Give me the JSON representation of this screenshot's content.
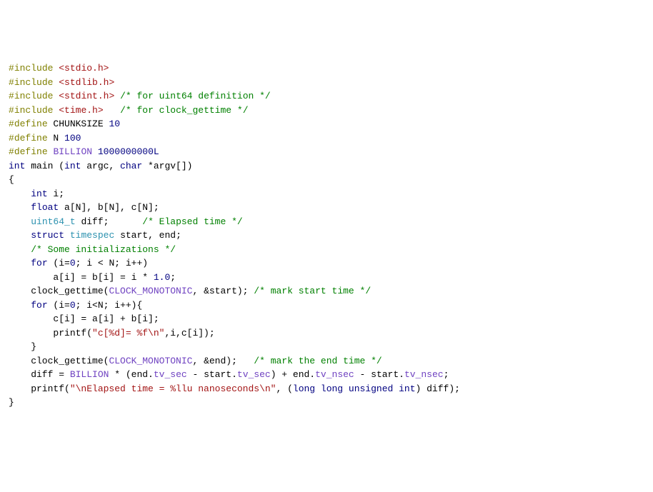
{
  "code": {
    "lines": [
      {
        "tokens": [
          {
            "t": "#",
            "c": "k-pre"
          },
          {
            "t": "include",
            "c": "k-pre"
          },
          {
            "t": " "
          },
          {
            "t": "<stdio.h>",
            "c": "str"
          }
        ]
      },
      {
        "tokens": [
          {
            "t": "#",
            "c": "k-pre"
          },
          {
            "t": "include",
            "c": "k-pre"
          },
          {
            "t": " "
          },
          {
            "t": "<stdlib.h>",
            "c": "str"
          }
        ]
      },
      {
        "tokens": [
          {
            "t": "#",
            "c": "k-pre"
          },
          {
            "t": "include",
            "c": "k-pre"
          },
          {
            "t": " "
          },
          {
            "t": "<stdint.h>",
            "c": "str"
          },
          {
            "t": " "
          },
          {
            "t": "/* for uint64 definition */",
            "c": "cmt"
          }
        ]
      },
      {
        "tokens": [
          {
            "t": "#",
            "c": "k-pre"
          },
          {
            "t": "include",
            "c": "k-pre"
          },
          {
            "t": " "
          },
          {
            "t": "<time.h>",
            "c": "str"
          },
          {
            "t": "   "
          },
          {
            "t": "/* for clock_gettime */",
            "c": "cmt"
          }
        ]
      },
      {
        "tokens": [
          {
            "t": ""
          }
        ]
      },
      {
        "tokens": [
          {
            "t": "#",
            "c": "k-pre"
          },
          {
            "t": "define",
            "c": "k-pre"
          },
          {
            "t": " CHUNKSIZE "
          },
          {
            "t": "10",
            "c": "num"
          }
        ]
      },
      {
        "tokens": [
          {
            "t": "#",
            "c": "k-pre"
          },
          {
            "t": "define",
            "c": "k-pre"
          },
          {
            "t": " N "
          },
          {
            "t": "100",
            "c": "num"
          }
        ]
      },
      {
        "tokens": [
          {
            "t": "#",
            "c": "k-pre"
          },
          {
            "t": "define",
            "c": "k-pre"
          },
          {
            "t": " "
          },
          {
            "t": "BILLION",
            "c": "const"
          },
          {
            "t": " "
          },
          {
            "t": "1000000000L",
            "c": "num"
          }
        ]
      },
      {
        "tokens": [
          {
            "t": ""
          }
        ]
      },
      {
        "tokens": [
          {
            "t": ""
          }
        ]
      },
      {
        "tokens": [
          {
            "t": "int",
            "c": "k-type"
          },
          {
            "t": " main ("
          },
          {
            "t": "int",
            "c": "k-type"
          },
          {
            "t": " argc, "
          },
          {
            "t": "char",
            "c": "k-type"
          },
          {
            "t": " *argv[])"
          }
        ]
      },
      {
        "tokens": [
          {
            "t": "{"
          }
        ]
      },
      {
        "tokens": [
          {
            "t": "    "
          },
          {
            "t": "int",
            "c": "k-type"
          },
          {
            "t": " i;"
          }
        ]
      },
      {
        "tokens": [
          {
            "t": "    "
          },
          {
            "t": "float",
            "c": "k-type"
          },
          {
            "t": " a[N], b[N], c[N];"
          }
        ]
      },
      {
        "tokens": [
          {
            "t": "    "
          },
          {
            "t": "uint64_t",
            "c": "typeuse"
          },
          {
            "t": " diff;      "
          },
          {
            "t": "/* Elapsed time */",
            "c": "cmt"
          }
        ]
      },
      {
        "tokens": [
          {
            "t": "    "
          },
          {
            "t": "struct",
            "c": "k-type"
          },
          {
            "t": " "
          },
          {
            "t": "timespec",
            "c": "typeuse"
          },
          {
            "t": " start, end;"
          }
        ]
      },
      {
        "tokens": [
          {
            "t": ""
          }
        ]
      },
      {
        "tokens": [
          {
            "t": ""
          }
        ]
      },
      {
        "tokens": [
          {
            "t": "    "
          },
          {
            "t": "/* Some initializations */",
            "c": "cmt"
          }
        ]
      },
      {
        "tokens": [
          {
            "t": "    "
          },
          {
            "t": "for",
            "c": "k-ctrl"
          },
          {
            "t": " (i="
          },
          {
            "t": "0",
            "c": "num"
          },
          {
            "t": "; i < N; i++)"
          }
        ]
      },
      {
        "tokens": [
          {
            "t": "        a[i] = b[i] = i * "
          },
          {
            "t": "1.0",
            "c": "num"
          },
          {
            "t": ";"
          }
        ]
      },
      {
        "tokens": [
          {
            "t": ""
          }
        ]
      },
      {
        "tokens": [
          {
            "t": "    clock_gettime("
          },
          {
            "t": "CLOCK_MONOTONIC",
            "c": "const"
          },
          {
            "t": ", &start); "
          },
          {
            "t": "/* mark start time */",
            "c": "cmt"
          }
        ]
      },
      {
        "tokens": [
          {
            "t": "    "
          },
          {
            "t": "for",
            "c": "k-ctrl"
          },
          {
            "t": " (i="
          },
          {
            "t": "0",
            "c": "num"
          },
          {
            "t": "; i<N; i++){"
          }
        ]
      },
      {
        "tokens": [
          {
            "t": "        c[i] = a[i] + b[i];"
          }
        ]
      },
      {
        "tokens": [
          {
            "t": "        printf("
          },
          {
            "t": "\"c[%d]= %f\\n\"",
            "c": "str"
          },
          {
            "t": ",i,c[i]);"
          }
        ]
      },
      {
        "tokens": [
          {
            "t": "    }"
          }
        ]
      },
      {
        "tokens": [
          {
            "t": "    clock_gettime("
          },
          {
            "t": "CLOCK_MONOTONIC",
            "c": "const"
          },
          {
            "t": ", &end);   "
          },
          {
            "t": "/* mark the end time */",
            "c": "cmt"
          }
        ]
      },
      {
        "tokens": [
          {
            "t": ""
          }
        ]
      },
      {
        "tokens": [
          {
            "t": "    diff = "
          },
          {
            "t": "BILLION",
            "c": "const"
          },
          {
            "t": " * (end."
          },
          {
            "t": "tv_sec",
            "c": "member"
          },
          {
            "t": " - start."
          },
          {
            "t": "tv_sec",
            "c": "member"
          },
          {
            "t": ") + end."
          },
          {
            "t": "tv_nsec",
            "c": "member"
          },
          {
            "t": " - start."
          },
          {
            "t": "tv_nsec",
            "c": "member"
          },
          {
            "t": ";"
          }
        ]
      },
      {
        "tokens": [
          {
            "t": "    printf("
          },
          {
            "t": "\"\\nElapsed time = %llu nanoseconds\\n\"",
            "c": "str"
          },
          {
            "t": ", ("
          },
          {
            "t": "long long unsigned int",
            "c": "k-type"
          },
          {
            "t": ") diff);"
          }
        ]
      },
      {
        "tokens": [
          {
            "t": ""
          }
        ]
      },
      {
        "tokens": [
          {
            "t": "}"
          }
        ]
      }
    ]
  }
}
